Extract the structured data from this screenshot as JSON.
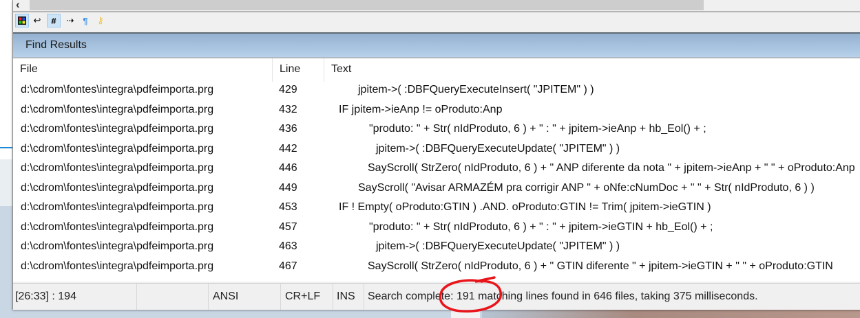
{
  "toolbar": {
    "icons": [
      "color-grid-icon",
      "word-wrap-icon",
      "line-numbers-icon",
      "tab-arrow-icon",
      "pilcrow-icon",
      "key-icon"
    ]
  },
  "panel": {
    "title": "Find Results"
  },
  "columns": {
    "file": "File",
    "line": "Line",
    "text": "Text"
  },
  "rows": [
    {
      "file": "d:\\cdrom\\fontes\\integra\\pdfeimporta.prg",
      "line": "429",
      "text": "jpitem->( :DBFQueryExecuteInsert( \"JPITEM\" ) )"
    },
    {
      "file": "d:\\cdrom\\fontes\\integra\\pdfeimporta.prg",
      "line": "432",
      "text": "IF jpitem->ieAnp != oProduto:Anp"
    },
    {
      "file": "d:\\cdrom\\fontes\\integra\\pdfeimporta.prg",
      "line": "436",
      "text": "\"produto: \" + Str( nIdProduto, 6 ) + \" : \" + jpitem->ieAnp + hb_Eol() + ;"
    },
    {
      "file": "d:\\cdrom\\fontes\\integra\\pdfeimporta.prg",
      "line": "442",
      "text": "jpitem->( :DBFQueryExecuteUpdate( \"JPITEM\" ) )"
    },
    {
      "file": "d:\\cdrom\\fontes\\integra\\pdfeimporta.prg",
      "line": "446",
      "text": "SayScroll( StrZero( nIdProduto, 6 ) + \" ANP diferente da nota \" + jpitem->ieAnp + \" \" + oProduto:Anp"
    },
    {
      "file": "d:\\cdrom\\fontes\\integra\\pdfeimporta.prg",
      "line": "449",
      "text": "SayScroll( \"Avisar ARMAZÉM pra corrigir ANP \" + oNfe:cNumDoc + \" \" + Str( nIdProduto, 6 ) )"
    },
    {
      "file": "d:\\cdrom\\fontes\\integra\\pdfeimporta.prg",
      "line": "453",
      "text": "IF ! Empty( oProduto:GTIN ) .AND. oProduto:GTIN != Trim( jpitem->ieGTIN )"
    },
    {
      "file": "d:\\cdrom\\fontes\\integra\\pdfeimporta.prg",
      "line": "457",
      "text": "\"produto: \" + Str( nIdProduto, 6 ) + \" : \" + jpitem->ieGTIN + hb_Eol() + ;"
    },
    {
      "file": "d:\\cdrom\\fontes\\integra\\pdfeimporta.prg",
      "line": "463",
      "text": "jpitem->( :DBFQueryExecuteUpdate( \"JPITEM\" ) )"
    },
    {
      "file": "d:\\cdrom\\fontes\\integra\\pdfeimporta.prg",
      "line": "467",
      "text": "SayScroll( StrZero( nIdProduto, 6 ) + \" GTIN diferente \" + jpitem->ieGTIN + \" \" + oProduto:GTIN"
    }
  ],
  "status": {
    "position": "[26:33] : 194",
    "encoding": "ANSI",
    "line_ending": "CR+LF",
    "mode": "INS",
    "message": "Search complete: 191 matching lines found in 646 files, taking 375 milliseconds."
  },
  "colors": {
    "header_top": "#94b1d0",
    "header_bottom": "#b7d1ea",
    "annotation": "#e8151b"
  }
}
